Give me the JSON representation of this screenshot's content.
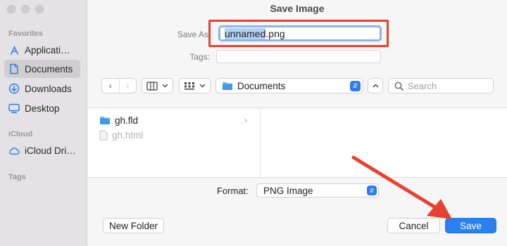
{
  "window": {
    "title": "Save Image"
  },
  "sidebar": {
    "sections": [
      {
        "label": "Favorites"
      },
      {
        "label": "iCloud"
      },
      {
        "label": "Tags"
      }
    ],
    "items": [
      {
        "label": "Applicati…",
        "icon": "applications-icon"
      },
      {
        "label": "Documents",
        "icon": "document-icon",
        "active": true
      },
      {
        "label": "Downloads",
        "icon": "download-icon"
      },
      {
        "label": "Desktop",
        "icon": "desktop-icon"
      },
      {
        "label": "iCloud Dri…",
        "icon": "cloud-icon"
      }
    ]
  },
  "form": {
    "save_as_label": "Save As",
    "filename_selected": "unnamed",
    "filename_ext": ".png",
    "tags_label": "Tags:"
  },
  "toolbar": {
    "back": "‹",
    "forward": "›",
    "location": "Documents",
    "search_placeholder": "Search"
  },
  "browser": {
    "files": [
      {
        "name": "gh.fld",
        "type": "folder"
      },
      {
        "name": "gh.html",
        "type": "file",
        "dimmed": true
      }
    ]
  },
  "format": {
    "label": "Format:",
    "value": "PNG Image"
  },
  "buttons": {
    "new_folder": "New Folder",
    "cancel": "Cancel",
    "save": "Save"
  },
  "colors": {
    "accent": "#2a7ff1",
    "annotation": "#e8412f"
  }
}
